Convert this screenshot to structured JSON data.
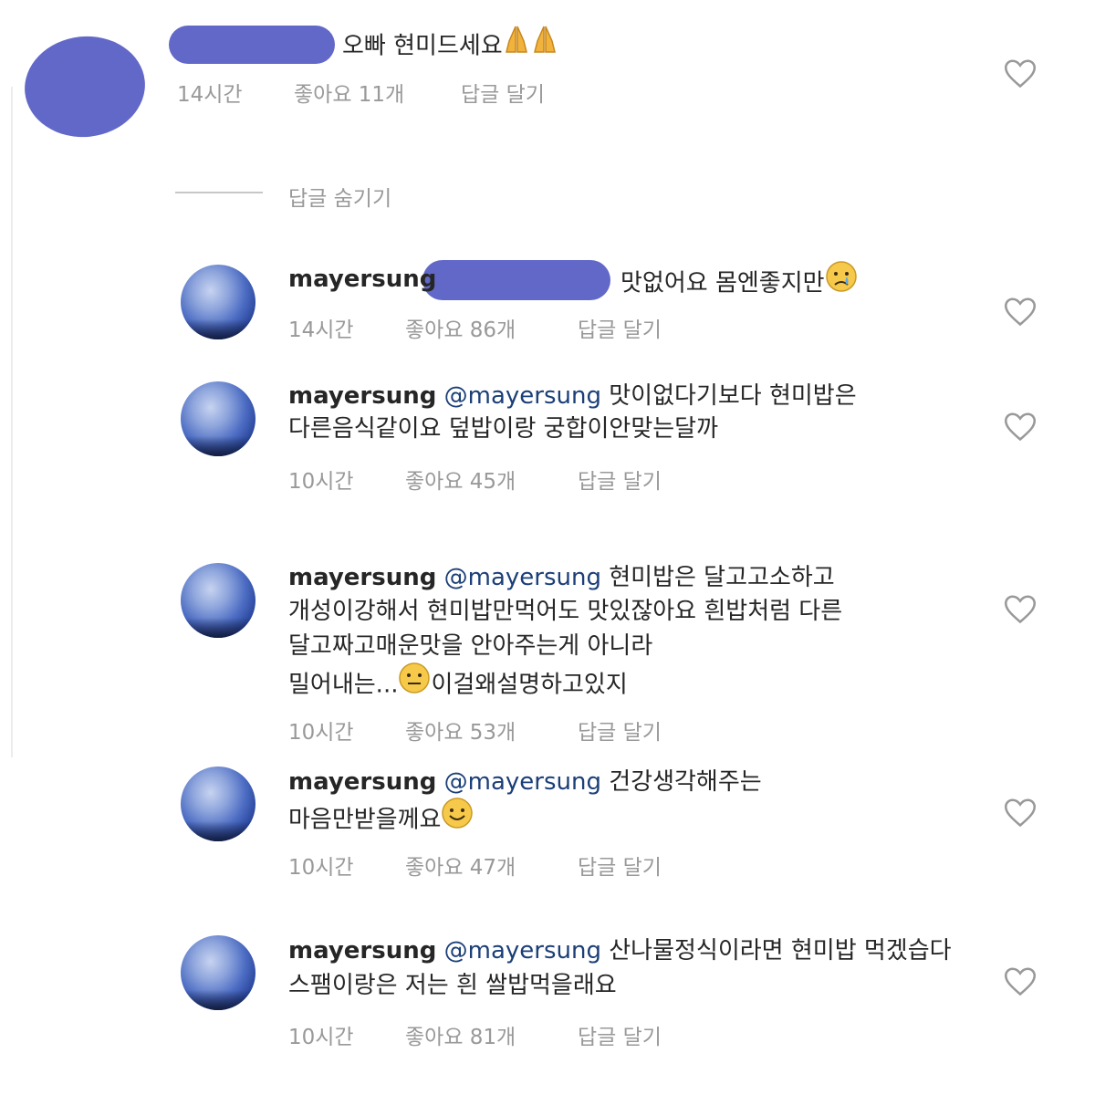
{
  "comment": {
    "text": "오빠 현미드세요",
    "time": "14시간",
    "likes": "좋아요 11개",
    "reply": "답글 달기"
  },
  "hide_replies": "답글 숨기기",
  "replies": [
    {
      "username": "mayersung",
      "text": "맛없어요 몸엔좋지만",
      "time": "14시간",
      "likes": "좋아요 86개",
      "reply": "답글 달기"
    },
    {
      "username": "mayersung",
      "mention": "@mayersung",
      "line1": "맛이없다기보다 현미밥은",
      "line2": "다른음식같이요 덮밥이랑 궁합이안맞는달까",
      "time": "10시간",
      "likes": "좋아요 45개",
      "reply": "답글 달기"
    },
    {
      "username": "mayersung",
      "mention": "@mayersung",
      "line1": "현미밥은 달고고소하고",
      "line2": "개성이강해서 현미밥만먹어도 맛있잖아요 흰밥처럼 다른",
      "line3": "달고짜고매운맛을 안아주는게 아니라",
      "line4a": "밀어내는...",
      "line4b": "이걸왜설명하고있지",
      "time": "10시간",
      "likes": "좋아요 53개",
      "reply": "답글 달기"
    },
    {
      "username": "mayersung",
      "mention": "@mayersung",
      "line1": "건강생각해주는",
      "line2": "마음만받을께요",
      "time": "10시간",
      "likes": "좋아요 47개",
      "reply": "답글 달기"
    },
    {
      "username": "mayersung",
      "mention": "@mayersung",
      "line1": "산나물정식이라면 현미밥 먹겠습다",
      "line2": "스팸이랑은 저는 흰 쌀밥먹을래요",
      "time": "10시간",
      "likes": "좋아요 81개",
      "reply": "답글 달기"
    }
  ],
  "icons": {
    "heart": "heart-outline-icon",
    "pray": "folded-hands-emoji",
    "cry": "crying-face-emoji",
    "neutral": "neutral-face-emoji",
    "smile": "smiling-face-emoji"
  },
  "colors": {
    "redaction": "#6268c8",
    "mention": "#1b3f78",
    "meta": "#999999",
    "text": "#262626"
  }
}
